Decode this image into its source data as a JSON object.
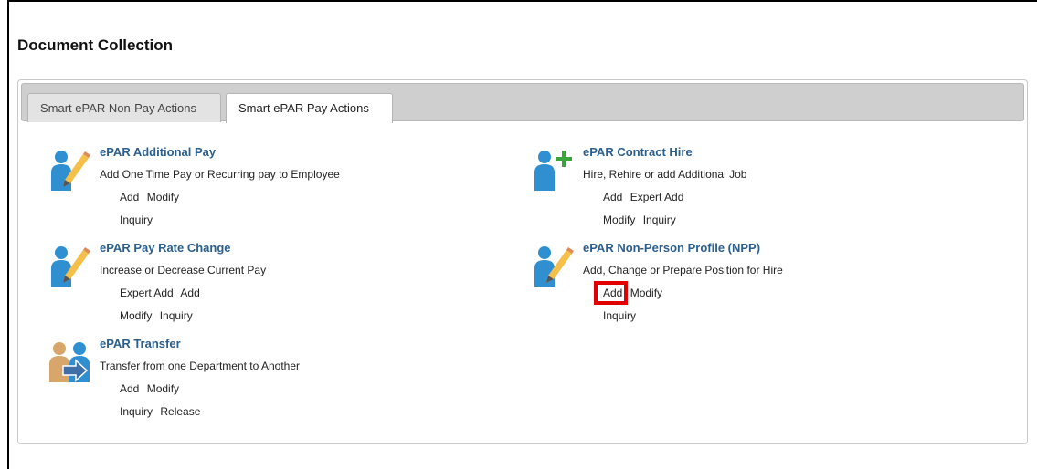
{
  "page": {
    "title": "Document Collection"
  },
  "tabs": [
    {
      "label": "Smart ePAR Non-Pay Actions",
      "active": false
    },
    {
      "label": "Smart ePAR Pay Actions",
      "active": true
    }
  ],
  "items": {
    "additional_pay": {
      "title": "ePAR Additional Pay",
      "desc": "Add One Time Pay or Recurring pay to Employee",
      "links_row1": [
        "Add",
        "Modify"
      ],
      "links_row2": [
        "Inquiry"
      ],
      "icon": "person-pencil-icon"
    },
    "contract_hire": {
      "title": "ePAR Contract Hire",
      "desc": "Hire, Rehire or add Additional Job",
      "links_row1": [
        "Add",
        "Expert Add"
      ],
      "links_row2": [
        "Modify",
        "Inquiry"
      ],
      "icon": "person-plus-icon"
    },
    "pay_rate_change": {
      "title": "ePAR Pay Rate Change",
      "desc": "Increase or Decrease Current Pay",
      "links_row1": [
        "Expert Add",
        "Add"
      ],
      "links_row2": [
        "Modify",
        "Inquiry"
      ],
      "icon": "person-pencil-icon"
    },
    "npp": {
      "title": "ePAR Non-Person Profile (NPP)",
      "desc": "Add, Change or Prepare Position for Hire",
      "links_row1": [
        "Add",
        "Modify"
      ],
      "links_row2": [
        "Inquiry"
      ],
      "icon": "person-pencil-icon"
    },
    "transfer": {
      "title": "ePAR Transfer",
      "desc": "Transfer from one Department to Another",
      "links_row1": [
        "Add",
        "Modify"
      ],
      "links_row2": [
        "Inquiry",
        "Release"
      ],
      "icon": "people-transfer-icon"
    }
  },
  "colors": {
    "link_title": "#2a5f8f",
    "highlight": "#e00000",
    "icon_blue": "#2f8fd0",
    "icon_tan": "#d8a66a",
    "plus_green": "#3aa53a"
  }
}
